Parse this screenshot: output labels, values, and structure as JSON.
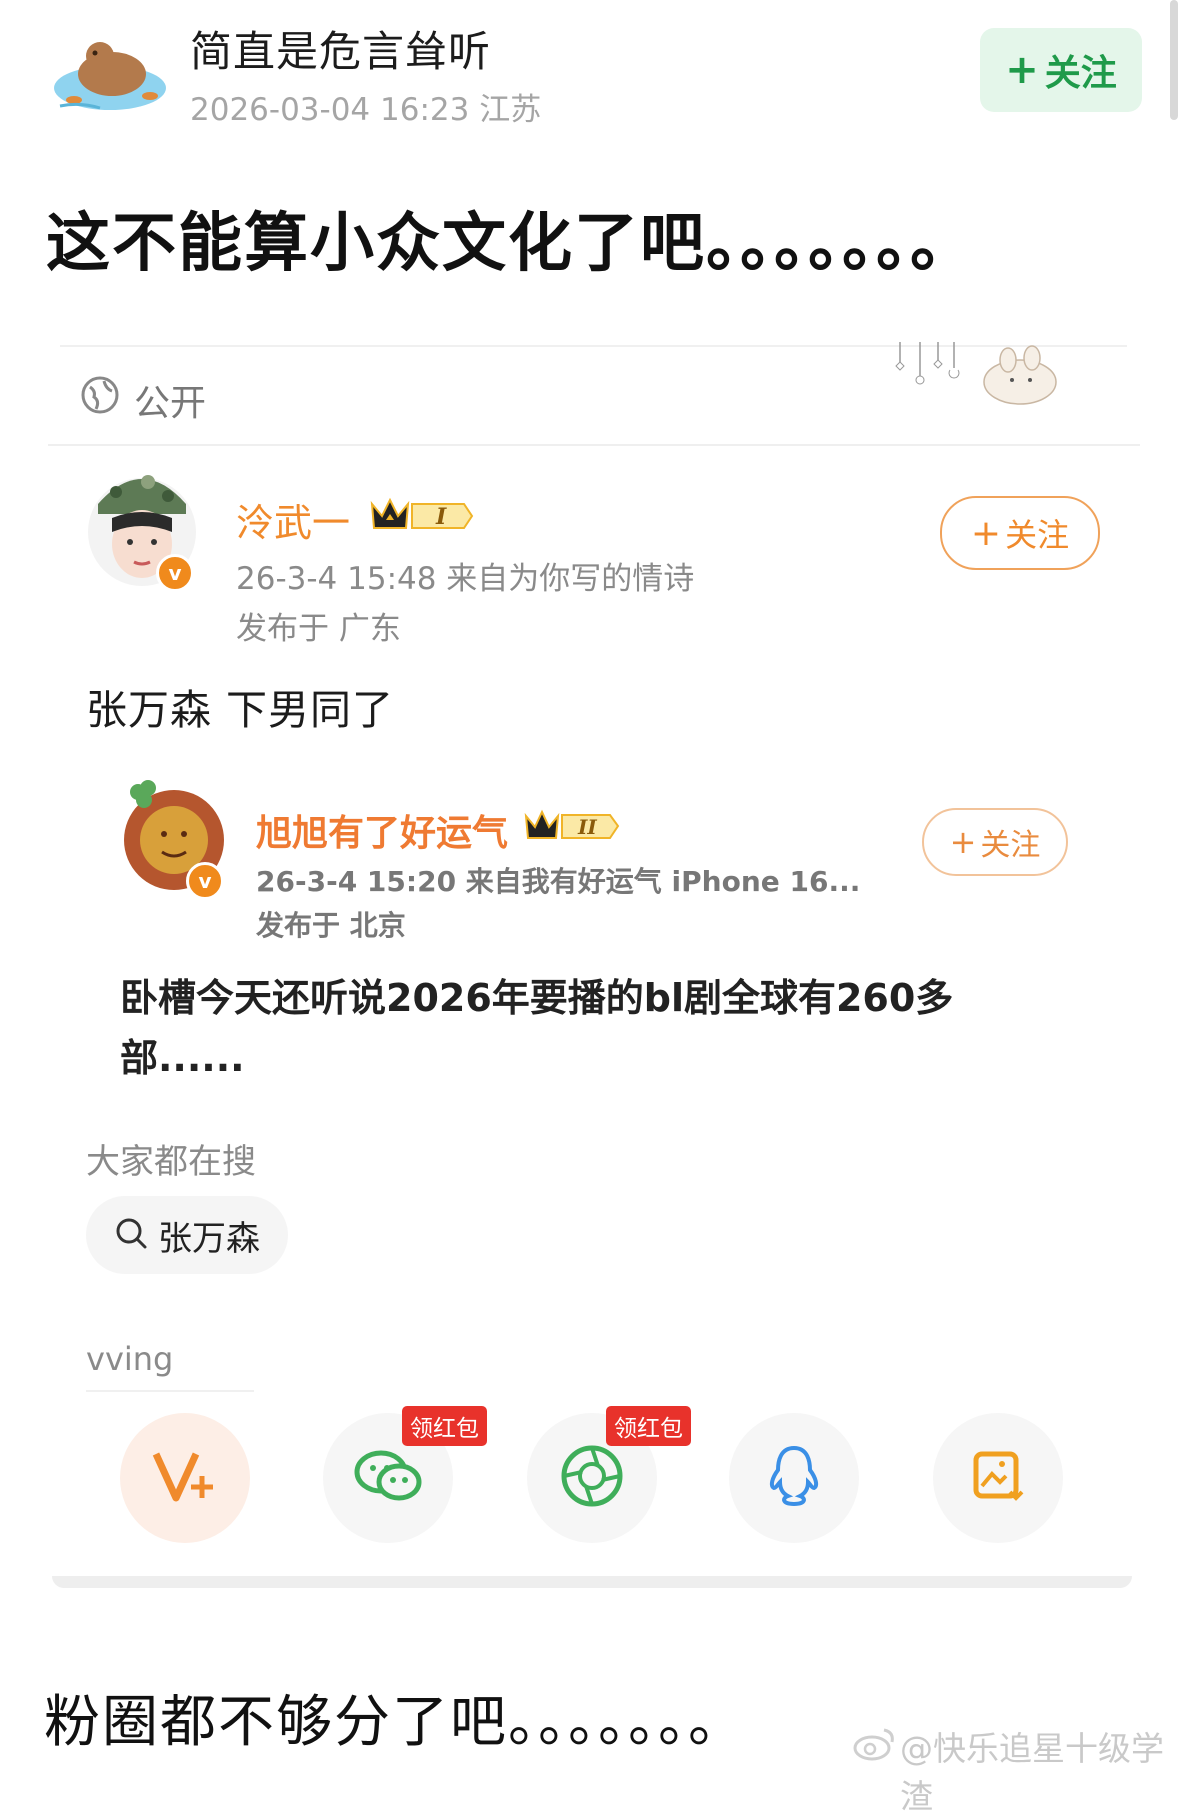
{
  "post": {
    "username": "简直是危言耸听",
    "meta": "2026-03-04 16:23  江苏",
    "follow_label": "关注",
    "headline": "这不能算小众文化了吧。。。。。。。"
  },
  "card": {
    "visibility": "公开",
    "main_post": {
      "username": "泠武一",
      "crown_level": "I",
      "time_source": "26-3-4 15:48  来自为你写的情诗",
      "location": "发布于 广东",
      "follow_label": "关注",
      "text": "张万森 下男同了"
    },
    "quoted_post": {
      "username": "旭旭有了好运气",
      "crown_level": "II",
      "time_source": "26-3-4 15:20  来自我有好运气 iPhone 16...",
      "location": "发布于 北京",
      "follow_label": "关注",
      "text": "卧槽今天还听说2026年要播的bl剧全球有260多部......"
    },
    "search": {
      "title": "大家都在搜",
      "chip": "张万森"
    },
    "share": {
      "label": "vving",
      "items": [
        {
          "icon": "vplus-icon",
          "badge": ""
        },
        {
          "icon": "wechat-icon",
          "badge": "领红包"
        },
        {
          "icon": "moments-icon",
          "badge": "领红包"
        },
        {
          "icon": "qq-icon",
          "badge": ""
        },
        {
          "icon": "save-image-icon",
          "badge": ""
        }
      ]
    }
  },
  "footer": {
    "text": "粉圈都不够分了吧。。。。。。。",
    "watermark": "@快乐追星十级学渣"
  },
  "colors": {
    "follow_green": "#1f9a4a",
    "follow_orange": "#f08a2c",
    "redpack": "#e8322b"
  }
}
